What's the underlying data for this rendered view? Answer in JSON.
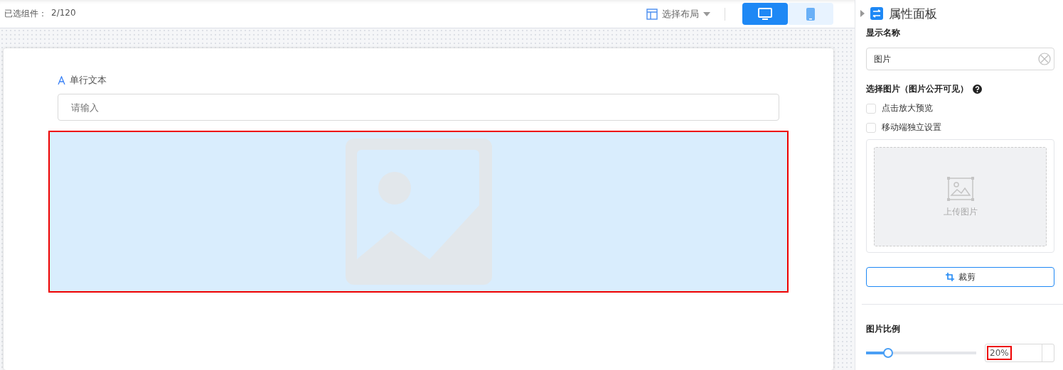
{
  "toolbar": {
    "selected_count_label": "已选组件：",
    "selected_count": "2/120",
    "layout_select": "选择布局",
    "devices": [
      {
        "kind": "desktop",
        "selected": true
      },
      {
        "kind": "mobile",
        "selected": false
      }
    ]
  },
  "canvas": {
    "text_field": {
      "label": "单行文本",
      "placeholder": "请输入"
    },
    "image_component": {
      "selected": true
    }
  },
  "panel": {
    "title": "属性面板",
    "name_label": "显示名称",
    "name_value": "图片",
    "image_label": "选择图片（图片公开可见）",
    "options": [
      {
        "label": "点击放大预览",
        "checked": false
      },
      {
        "label": "移动端独立设置",
        "checked": false
      }
    ],
    "upload_label": "上传图片",
    "crop_button": "裁剪",
    "ratio_label": "图片比例",
    "ratio": {
      "level": 0.2,
      "value": "20%"
    }
  }
}
